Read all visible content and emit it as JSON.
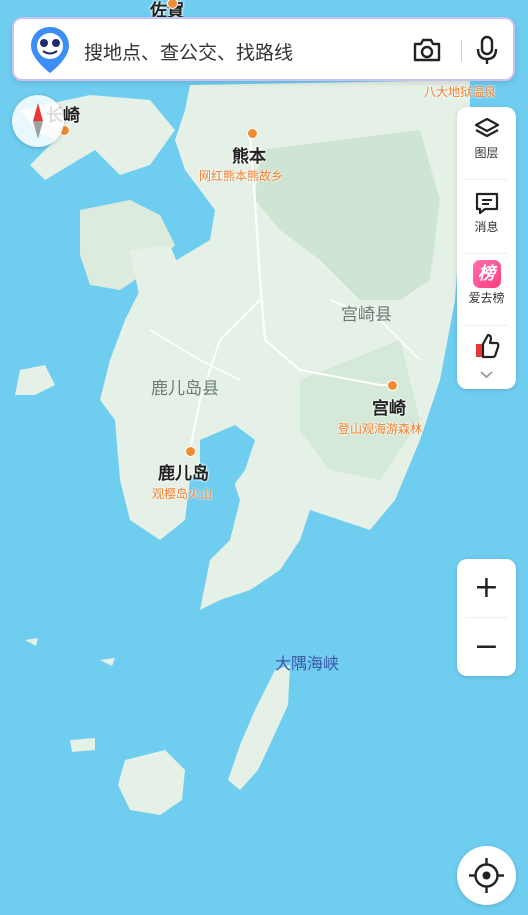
{
  "search": {
    "placeholder": "搜地点、查公交、找路线",
    "camera_icon": "camera-icon",
    "mic_icon": "microphone-icon"
  },
  "compass": {
    "icon": "compass-icon"
  },
  "panel": {
    "layers_label": "图层",
    "messages_label": "消息",
    "ranking_badge": "榜",
    "ranking_label": "爱去榜",
    "thumb_icon": "thumbs-up-icon",
    "more_icon": "chevron-down-icon"
  },
  "zoom": {
    "in_label": "+",
    "out_label": "−"
  },
  "locate": {
    "icon": "locate-icon"
  },
  "map": {
    "cities": {
      "top_partial": "佐賀",
      "nagasaki": "长崎",
      "kumamoto": "熊本",
      "miyazaki": "宫崎",
      "kagoshima": "鹿儿岛"
    },
    "pois": {
      "kumamoto_poi": "网红熊本熊故乡",
      "hachidai": "八大地狱温泉",
      "miyazaki_poi": "登山观海游森林",
      "kagoshima_poi": "观樱岛火山"
    },
    "regions": {
      "miyazaki_pref": "宫崎县",
      "kagoshima_pref": "鹿儿岛县"
    },
    "water": {
      "strait": "大隅海峡"
    }
  },
  "colors": {
    "sea": "#6fcdf0",
    "land": "#e5f1e6",
    "forest": "#cfe5d3",
    "poi": "#f07e2e",
    "strait_label": "#3d5aa8"
  }
}
